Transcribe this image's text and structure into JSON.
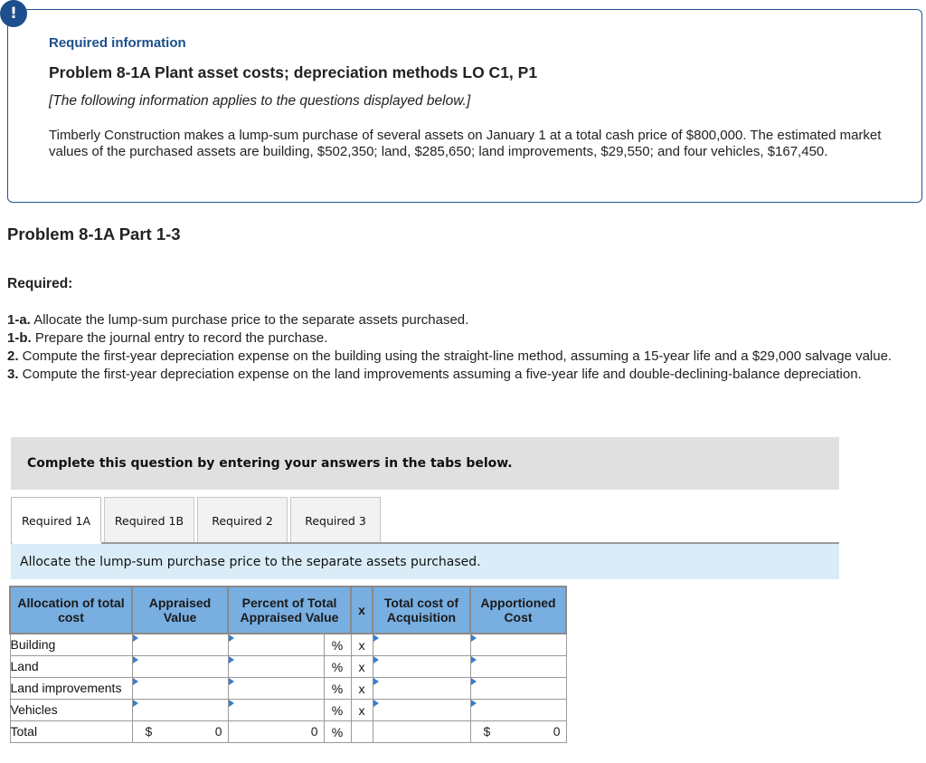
{
  "alert": {
    "icon": "exclamation-icon",
    "glyph": "!",
    "color": "#1c4f8c"
  },
  "info": {
    "heading": "Required information",
    "title": "Problem 8-1A Plant asset costs; depreciation methods LO C1, P1",
    "applies_note": "[The following information applies to the questions displayed below.]",
    "scenario": "Timberly Construction makes a lump-sum purchase of several assets on January 1 at a total cash price of $800,000. The estimated market values of the purchased assets are building, $502,350; land, $285,650; land improvements, $29,550; and four vehicles, $167,450."
  },
  "part_title": "Problem 8-1A Part 1-3",
  "required_label": "Required:",
  "requirements": [
    {
      "num": "1-a.",
      "text": " Allocate the lump-sum purchase price to the separate assets purchased."
    },
    {
      "num": "1-b.",
      "text": " Prepare the journal entry to record the purchase."
    },
    {
      "num": "2.",
      "text": " Compute the first-year depreciation expense on the building using the straight-line method, assuming a 15-year life and a $29,000 salvage value."
    },
    {
      "num": "3.",
      "text": " Compute the first-year depreciation expense on the land improvements assuming a five-year life and double-declining-balance depreciation."
    }
  ],
  "instruction": "Complete this question by entering your answers in the tabs below.",
  "tabs": [
    {
      "label": "Required 1A",
      "active": true
    },
    {
      "label": "Required 1B",
      "active": false
    },
    {
      "label": "Required 2",
      "active": false
    },
    {
      "label": "Required 3",
      "active": false
    }
  ],
  "prompt": "Allocate the lump-sum purchase price to the separate assets purchased.",
  "table": {
    "headers": {
      "allocation": "Allocation of total cost",
      "appraised": "Appraised Value",
      "percent": "Percent of Total Appraised Value",
      "times": "x",
      "total_cost": "Total cost of Acquisition",
      "apportioned": "Apportioned Cost"
    },
    "rows": [
      {
        "label": "Building",
        "appraised": "",
        "percent": "",
        "pct_sign": "%",
        "x": "x",
        "total_cost": "",
        "apportioned": ""
      },
      {
        "label": "Land",
        "appraised": "",
        "percent": "",
        "pct_sign": "%",
        "x": "x",
        "total_cost": "",
        "apportioned": ""
      },
      {
        "label": "Land improvements",
        "appraised": "",
        "percent": "",
        "pct_sign": "%",
        "x": "x",
        "total_cost": "",
        "apportioned": ""
      },
      {
        "label": "Vehicles",
        "appraised": "",
        "percent": "",
        "pct_sign": "%",
        "x": "x",
        "total_cost": "",
        "apportioned": ""
      }
    ],
    "total": {
      "label": "Total",
      "appraised_currency": "$",
      "appraised_value": "0",
      "percent_value": "0",
      "pct_sign": "%",
      "apportioned_currency": "$",
      "apportioned_value": "0"
    }
  },
  "colors": {
    "header_bg": "#78aee0",
    "input_border": "#5b82b4",
    "instruction_bg": "#e0e0e0",
    "prompt_bg": "#d9ecf7",
    "info_border": "#1f5490"
  }
}
